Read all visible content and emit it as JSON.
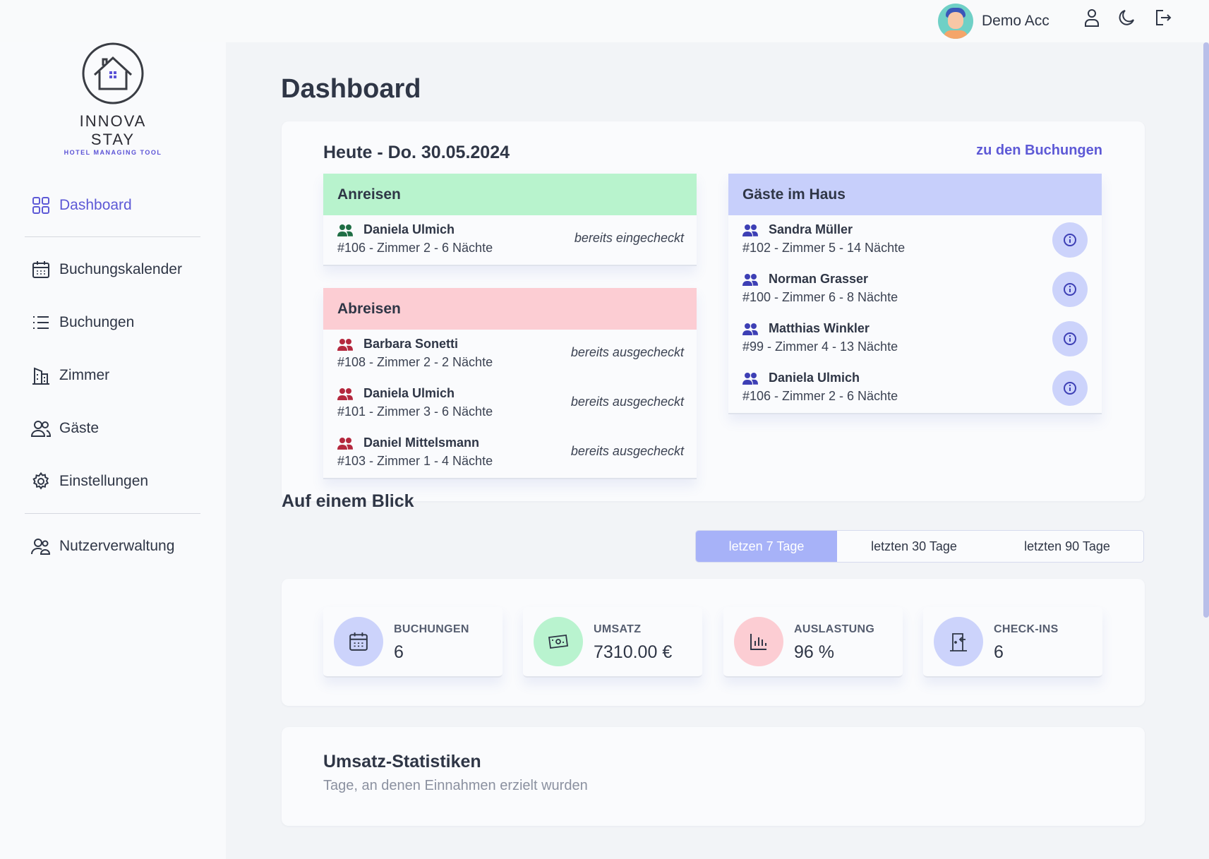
{
  "app": {
    "name": "INNOVA STAY",
    "tagline": "HOTEL MANAGING TOOL"
  },
  "user": {
    "name": "Demo Acc"
  },
  "topbar": {
    "icons": [
      "user-icon",
      "moon-icon",
      "logout-icon"
    ]
  },
  "sidebar": {
    "items": [
      {
        "label": "Dashboard",
        "icon": "dashboard-grid-icon",
        "active": true
      },
      {
        "label": "Buchungskalender",
        "icon": "calendar-icon"
      },
      {
        "label": "Buchungen",
        "icon": "list-icon"
      },
      {
        "label": "Zimmer",
        "icon": "building-icon"
      },
      {
        "label": "Gäste",
        "icon": "users-icon"
      },
      {
        "label": "Einstellungen",
        "icon": "gear-icon"
      },
      {
        "label": "Nutzerverwaltung",
        "icon": "user-management-icon"
      }
    ]
  },
  "page": {
    "title": "Dashboard"
  },
  "today": {
    "title": "Heute - Do. 30.05.2024",
    "link": "zu den Buchungen",
    "arrivals": {
      "title": "Anreisen",
      "rows": [
        {
          "name": "Daniela Ulmich",
          "detail": "#106 - Zimmer 2 - 6 Nächte",
          "status": "bereits eingecheckt"
        }
      ]
    },
    "departures": {
      "title": "Abreisen",
      "rows": [
        {
          "name": "Barbara Sonetti",
          "detail": "#108 - Zimmer 2 - 2 Nächte",
          "status": "bereits ausgecheckt"
        },
        {
          "name": "Daniela Ulmich",
          "detail": "#101 - Zimmer 3 - 6 Nächte",
          "status": "bereits ausgecheckt"
        },
        {
          "name": "Daniel Mittelsmann",
          "detail": "#103 - Zimmer 1 - 4 Nächte",
          "status": "bereits ausgecheckt"
        }
      ]
    },
    "guests": {
      "title": "Gäste im Haus",
      "rows": [
        {
          "name": "Sandra Müller",
          "detail": "#102 - Zimmer 5 - 14 Nächte"
        },
        {
          "name": "Norman Grasser",
          "detail": "#100 - Zimmer 6 - 8 Nächte"
        },
        {
          "name": "Matthias Winkler",
          "detail": "#99 - Zimmer 4 - 13 Nächte"
        },
        {
          "name": "Daniela Ulmich",
          "detail": "#106 - Zimmer 2 - 6 Nächte"
        }
      ]
    }
  },
  "overview": {
    "title": "Auf einem Blick",
    "ranges": [
      {
        "label": "letzen 7 Tage",
        "active": true
      },
      {
        "label": "letzten 30 Tage"
      },
      {
        "label": "letzten 90 Tage"
      }
    ],
    "kpis": [
      {
        "label": "BUCHUNGEN",
        "value": "6",
        "icon": "calendar-icon",
        "color": "#ccd3fb"
      },
      {
        "label": "UMSATZ",
        "value": "7310.00 €",
        "icon": "money-icon",
        "color": "#b9f3cf"
      },
      {
        "label": "AUSLASTUNG",
        "value": "96 %",
        "icon": "bar-chart-icon",
        "color": "#fccdd3"
      },
      {
        "label": "CHECK-INS",
        "value": "6",
        "icon": "door-enter-icon",
        "color": "#ccd3fb"
      }
    ]
  },
  "stats": {
    "title": "Umsatz-Statistiken",
    "subtitle": "Tage, an denen Einnahmen erzielt wurden"
  },
  "colors": {
    "accent": "#5d59d6",
    "arrivals_head": "#b8f3cd",
    "departures_head": "#fccdd3",
    "guests_head": "#c7cffb",
    "arrival_icon": "#1f6e45",
    "departure_icon": "#b4283e",
    "guest_icon": "#3d3fb5"
  }
}
